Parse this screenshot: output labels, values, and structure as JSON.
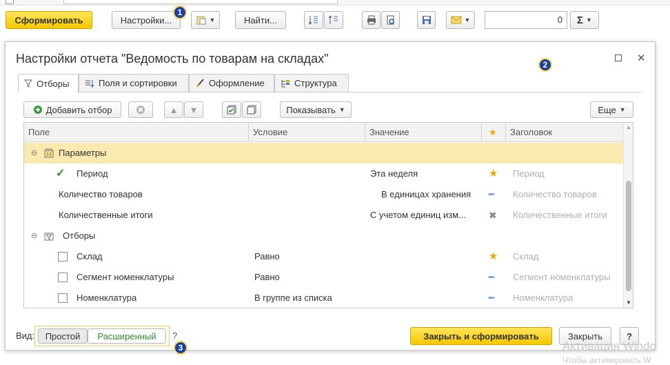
{
  "toolbar": {
    "generate_label": "Сформировать",
    "settings_label": "Настройки...",
    "find_label": "Найти...",
    "sum_value": "0",
    "sum_symbol": "Σ"
  },
  "badges": [
    "1",
    "2",
    "3"
  ],
  "dialog": {
    "title": "Настройки отчета \"Ведомость по товарам на складах\"",
    "tabs": [
      {
        "label": "Отборы",
        "icon": "funnel-icon"
      },
      {
        "label": "Поля и сортировки",
        "icon": "fields-sort-icon"
      },
      {
        "label": "Оформление",
        "icon": "brush-icon"
      },
      {
        "label": "Структура",
        "icon": "structure-icon"
      }
    ],
    "filters_toolbar": {
      "add_filter_label": "Добавить отбор",
      "show_label": "Показывать",
      "more_label": "Еще"
    },
    "grid": {
      "columns": [
        "Поле",
        "Условие",
        "Значение",
        "★",
        "Заголовок"
      ],
      "rows": [
        {
          "field": "Параметры",
          "condition": "",
          "value": "",
          "mark": "",
          "caption": "",
          "kind": "group"
        },
        {
          "field": "Период",
          "condition": "",
          "value": "Эта неделя",
          "mark": "star",
          "caption": "Период",
          "kind": "checked"
        },
        {
          "field": "Количество товаров",
          "condition": "",
          "value": "В единицах хранения",
          "mark": "dash",
          "caption": "Количество товаров",
          "kind": "param"
        },
        {
          "field": "Количественные итоги",
          "condition": "",
          "value": "С учетом единиц изм...",
          "mark": "x",
          "caption": "Количественные итоги",
          "kind": "param"
        },
        {
          "field": "Отборы",
          "condition": "",
          "value": "",
          "mark": "",
          "caption": "",
          "kind": "group"
        },
        {
          "field": "Склад",
          "condition": "Равно",
          "value": "",
          "mark": "star",
          "caption": "Склад",
          "kind": "unchecked"
        },
        {
          "field": "Сегмент номенклатуры",
          "condition": "Равно",
          "value": "",
          "mark": "dash",
          "caption": "Сегмент номенклатуры",
          "kind": "unchecked"
        },
        {
          "field": "Номенклатура",
          "condition": "В группе из списка",
          "value": "",
          "mark": "dash",
          "caption": "Номенклатура",
          "kind": "unchecked"
        }
      ]
    },
    "footer": {
      "view_label": "Вид:",
      "simple_label": "Простой",
      "extended_label": "Расширенный",
      "help_label": "?",
      "close_generate_label": "Закрыть и сформировать",
      "close_label": "Закрыть",
      "question_label": "?"
    }
  },
  "watermark": {
    "line1": "Активация Windo",
    "line2": "Чтобы активировать W"
  },
  "colors": {
    "accent_yellow": "#f5c800",
    "badge_blue": "#1a3ea8",
    "selected_row": "#fbeab0",
    "green_text": "#2e8b2e"
  }
}
